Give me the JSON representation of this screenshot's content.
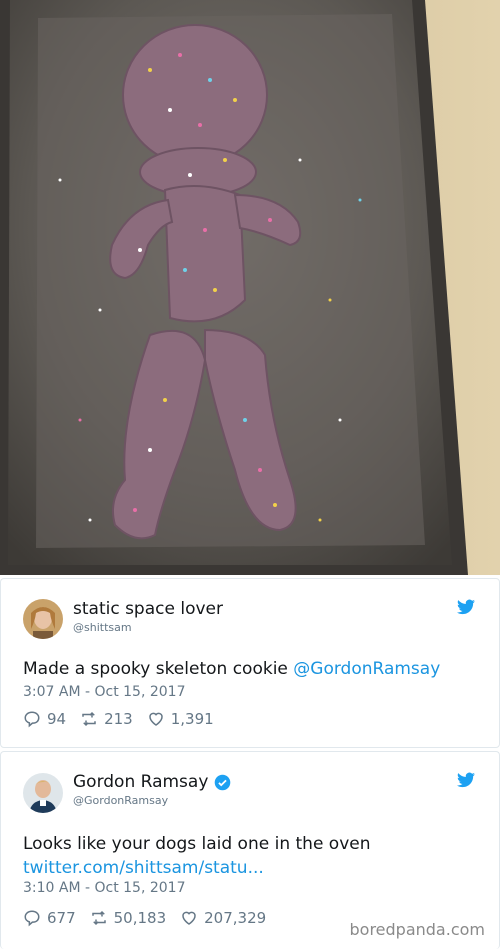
{
  "tweets": [
    {
      "display_name": "static space lover",
      "handle": "@shittsam",
      "text_plain": "Made a spooky skeleton cookie ",
      "mention": "@GordonRamsay",
      "timestamp": "3:07 AM - Oct 15, 2017",
      "replies": "94",
      "retweets": "213",
      "likes": "1,391"
    },
    {
      "display_name": "Gordon Ramsay",
      "verified": true,
      "handle": "@GordonRamsay",
      "text_line1": "Looks like your dogs laid one in the oven",
      "link": "twitter.com/shittsam/statu...",
      "timestamp": "3:10 AM - Oct 15, 2017",
      "replies": "677",
      "retweets": "50,183",
      "likes": "207,329"
    }
  ],
  "watermark": "boredpanda.com",
  "icons": {
    "bird": "twitter-bird-icon",
    "reply": "reply-icon",
    "retweet": "retweet-icon",
    "like": "heart-icon",
    "verified": "verified-badge-icon"
  },
  "colors": {
    "link": "#1b95e0",
    "muted": "#657786",
    "border": "#e1e8ed",
    "cookie": "#8a6b7a",
    "tray": "#5e5a55"
  }
}
